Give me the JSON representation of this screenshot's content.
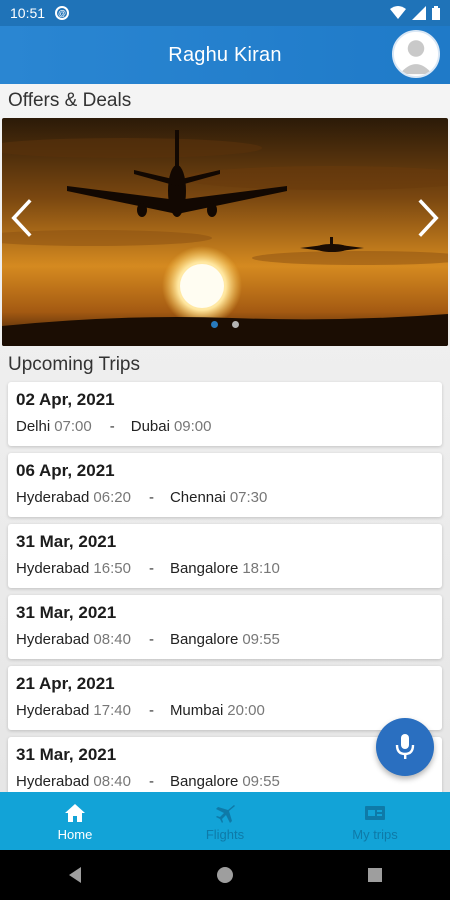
{
  "status_bar": {
    "time": "10:51"
  },
  "app_bar": {
    "title": "Raghu Kiran"
  },
  "offers": {
    "title": "Offers & Deals",
    "slide_count": 2,
    "active_slide": 1
  },
  "upcoming": {
    "title": "Upcoming Trips",
    "trips": [
      {
        "date": "02 Apr, 2021",
        "from_city": "Delhi",
        "from_time": "07:00",
        "separator": "-",
        "to_city": "Dubai",
        "to_time": "09:00"
      },
      {
        "date": "06 Apr, 2021",
        "from_city": "Hyderabad",
        "from_time": "06:20",
        "separator": "-",
        "to_city": "Chennai",
        "to_time": "07:30"
      },
      {
        "date": "31 Mar, 2021",
        "from_city": "Hyderabad",
        "from_time": "16:50",
        "separator": "-",
        "to_city": "Bangalore",
        "to_time": "18:10"
      },
      {
        "date": "31 Mar, 2021",
        "from_city": "Hyderabad",
        "from_time": "08:40",
        "separator": "-",
        "to_city": "Bangalore",
        "to_time": "09:55"
      },
      {
        "date": "21 Apr, 2021",
        "from_city": "Hyderabad",
        "from_time": "17:40",
        "separator": "-",
        "to_city": "Mumbai",
        "to_time": "20:00"
      },
      {
        "date": "31 Mar, 2021",
        "from_city": "Hyderabad",
        "from_time": "08:40",
        "separator": "-",
        "to_city": "Bangalore",
        "to_time": "09:55"
      }
    ]
  },
  "bottom_nav": {
    "items": [
      {
        "label": "Home",
        "icon": "home-icon",
        "active": true
      },
      {
        "label": "Flights",
        "icon": "airplane-icon",
        "active": false
      },
      {
        "label": "My trips",
        "icon": "ticket-icon",
        "active": false
      }
    ]
  },
  "colors": {
    "primary": "#2a86d2",
    "nav": "#12a3d7",
    "fab": "#2a6fc0"
  }
}
